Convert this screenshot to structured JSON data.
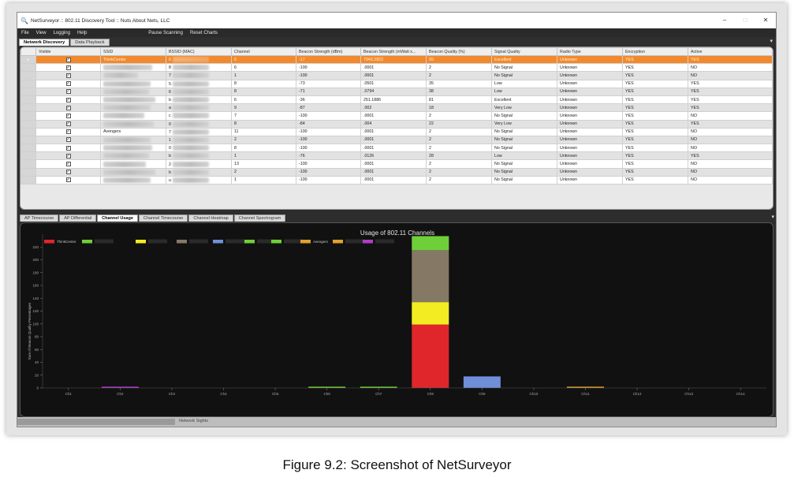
{
  "window": {
    "title": "NetSurveyor :: 802.11 Discovery Tool :: Nuts About Nets, LLC",
    "controls": [
      "–",
      "□",
      "✕"
    ]
  },
  "menu": [
    "File",
    "View",
    "Logging",
    "Help"
  ],
  "toolbar": [
    "Pause Scanning",
    "Reset Charts"
  ],
  "top_tabs": [
    {
      "label": "Network Discovery",
      "active": true
    },
    {
      "label": "Data Playback",
      "active": false
    }
  ],
  "grid": {
    "columns": [
      "Visible",
      "SSID",
      "BSSID (MAC)",
      "Channel",
      "Beacon Strength (dBm)",
      "Beacon Strength (mWatt x...",
      "Beacon Quality (%)",
      "Signal Quality",
      "Radio Type",
      "Encryption",
      "Active"
    ],
    "rows": [
      [
        "",
        "ThinkCenter",
        "6",
        "6",
        "-17",
        "7943.2822",
        "99",
        "Excellent",
        "Unknown",
        "YES",
        "YES"
      ],
      [
        "",
        "",
        "8",
        "6",
        "-100",
        ".0001",
        "2",
        "No Signal",
        "Unknown",
        "YES",
        "NO"
      ],
      [
        "",
        "",
        "7",
        "1",
        "-100",
        ".0001",
        "2",
        "No Signal",
        "Unknown",
        "YES",
        "NO"
      ],
      [
        "",
        "",
        "5",
        "8",
        "-73",
        ".0501",
        "35",
        "Low",
        "Unknown",
        "YES",
        "YES"
      ],
      [
        "",
        "",
        "6",
        "8",
        "-71",
        ".0794",
        "38",
        "Low",
        "Unknown",
        "YES",
        "YES"
      ],
      [
        "",
        "",
        "b",
        "6",
        "-36",
        "251.1886",
        "81",
        "Excellent",
        "Unknown",
        "YES",
        "YES"
      ],
      [
        "",
        "",
        "a",
        "9",
        "-87",
        ".002",
        "18",
        "Very Low",
        "Unknown",
        "YES",
        "YES"
      ],
      [
        "",
        "",
        "c",
        "7",
        "-100",
        ".0001",
        "2",
        "No Signal",
        "Unknown",
        "YES",
        "NO"
      ],
      [
        "",
        "",
        "0",
        "8",
        "-84",
        ".004",
        "22",
        "Very Low",
        "Unknown",
        "YES",
        "YES"
      ],
      [
        "",
        "Avengers",
        "7",
        "11",
        "-100",
        ".0001",
        "2",
        "No Signal",
        "Unknown",
        "YES",
        "NO"
      ],
      [
        "",
        "",
        "1",
        "2",
        "-100",
        ".0001",
        "2",
        "No Signal",
        "Unknown",
        "YES",
        "NO"
      ],
      [
        "",
        "",
        "0",
        "8",
        "-100",
        ".0001",
        "2",
        "No Signal",
        "Unknown",
        "YES",
        "NO"
      ],
      [
        "",
        "",
        "b",
        "1",
        "-76",
        ".0126",
        "28",
        "Low",
        "Unknown",
        "YES",
        "YES"
      ],
      [
        "",
        "",
        "2",
        "13",
        "-100",
        ".0001",
        "2",
        "No Signal",
        "Unknown",
        "YES",
        "NO"
      ],
      [
        "",
        "",
        "b",
        "2",
        "-100",
        ".0001",
        "2",
        "No Signal",
        "Unknown",
        "YES",
        "NO"
      ],
      [
        "",
        "",
        "u",
        "1",
        "-100",
        ".0001",
        "2",
        "No Signal",
        "Unknown",
        "YES",
        "NO"
      ]
    ]
  },
  "bottom_tabs": [
    {
      "label": "AP Timecourse",
      "active": false
    },
    {
      "label": "AP Differential",
      "active": false
    },
    {
      "label": "Channel Usage",
      "active": true
    },
    {
      "label": "Channel Timecourse",
      "active": false
    },
    {
      "label": "Channel Heatmap",
      "active": false
    },
    {
      "label": "Channel Spectrogram",
      "active": false
    }
  ],
  "chart_data": {
    "type": "bar",
    "title": "Usage of 802.11 Channels",
    "ylabel": "Sum of Beacon Quality Percentages",
    "xlabel": "",
    "categories": [
      "Ch1",
      "Ch2",
      "Ch3",
      "Ch4",
      "Ch5",
      "Ch6",
      "Ch7",
      "Ch8",
      "Ch9",
      "Ch10",
      "Ch11",
      "Ch12",
      "Ch13",
      "Ch14"
    ],
    "ylim": [
      0,
      240
    ],
    "yticks": [
      0,
      20,
      40,
      60,
      80,
      100,
      120,
      140,
      160,
      180,
      200,
      220
    ],
    "grid": false,
    "legend_position": "top-left",
    "legend": [
      {
        "name": "ThinkCenter",
        "color": "#e0262b"
      },
      {
        "name": "",
        "color": "#6fcf3a"
      },
      {
        "name": "",
        "color": "#f3ec22"
      },
      {
        "name": "",
        "color": "#857966"
      },
      {
        "name": "",
        "color": "#6f8fd8"
      },
      {
        "name": "",
        "color": "#6fcf3a"
      },
      {
        "name": "",
        "color": "#6fcf3a"
      },
      {
        "name": "Avengers",
        "color": "#e0a030"
      },
      {
        "name": "",
        "color": "#e0a030"
      },
      {
        "name": "",
        "color": "#b43cc8"
      }
    ],
    "stacks": [
      {
        "category": "Ch2",
        "segments": [
          {
            "value": 2,
            "color": "#b43cc8"
          }
        ]
      },
      {
        "category": "Ch6",
        "segments": [
          {
            "value": 2,
            "color": "#6fcf3a"
          }
        ]
      },
      {
        "category": "Ch7",
        "segments": [
          {
            "value": 2,
            "color": "#6fcf3a"
          }
        ]
      },
      {
        "category": "Ch8",
        "segments": [
          {
            "value": 99,
            "color": "#e0262b"
          },
          {
            "value": 35,
            "color": "#f3ec22"
          },
          {
            "value": 81,
            "color": "#857966"
          },
          {
            "value": 22,
            "color": "#6fcf3a"
          }
        ]
      },
      {
        "category": "Ch9",
        "segments": [
          {
            "value": 18,
            "color": "#6f8fd8"
          }
        ]
      },
      {
        "category": "Ch11",
        "segments": [
          {
            "value": 2,
            "color": "#e0a030"
          }
        ]
      }
    ],
    "legend_texts": [
      "ThinkCenter",
      "d",
      "Sd",
      "d",
      "c",
      "Du",
      "Avengers",
      "Dr",
      "c"
    ]
  },
  "status": {
    "label": "Network Sights"
  },
  "caption": "Figure 9.2: Screenshot of NetSurveyor",
  "colors": {
    "selected_row": "#f2892c",
    "chart_bg": "#111111"
  }
}
